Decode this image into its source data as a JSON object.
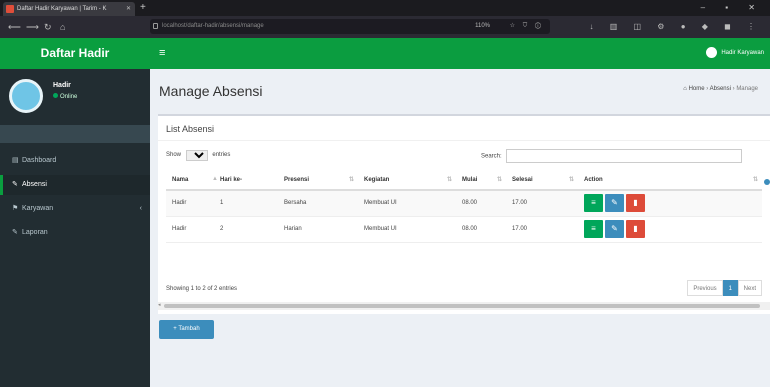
{
  "browser": {
    "tab_title": "Daftar Hadir Karyawan | Tarim - K",
    "new_tab": "+",
    "window_controls": "– ▪ ✕",
    "nav_back": "⟵",
    "nav_forward": "⟶",
    "nav_reload": "↻",
    "nav_home": "⌂",
    "url": "localhost/daftar-hadir/absensi/manage",
    "zoom": "110%",
    "url_tools": "☆ ⛉ ⓘ",
    "extensions": "↓ ▥ ◫ ⚙ ● ◆ ◼ ⋮"
  },
  "sidebar": {
    "brand": "Daftar Hadir",
    "user_name": "Hadir",
    "user_status": "Online",
    "menu": [
      {
        "icon": "▤",
        "label": "Dashboard"
      },
      {
        "icon": "✎",
        "label": "Absensi"
      },
      {
        "icon": "⚑",
        "label": "Karyawan"
      },
      {
        "icon": "✎",
        "label": "Laporan"
      }
    ],
    "caret": "‹"
  },
  "header": {
    "menu_toggle": "≡",
    "user_label": "Hadir Karyawan"
  },
  "page": {
    "title": "Manage Absensi",
    "breadcrumb": {
      "home": "⌂ Home",
      "sep1": "›",
      "section": "Absensi",
      "sep2": "›",
      "current": "Manage"
    }
  },
  "box": {
    "title": "List Absensi",
    "show_label": "Show",
    "show_value": "10",
    "entries_label": "entries",
    "search_label": "Search:",
    "search_placeholder": ""
  },
  "table": {
    "columns": [
      "Nama",
      "Hari ke-",
      "Presensi",
      "Kegiatan",
      "Mulai",
      "Selesai",
      "Action"
    ],
    "sort_glyph": "⇅",
    "sort_active": "▲",
    "rows": [
      [
        "Hadir",
        "1",
        "Bersaha",
        "Membuat UI",
        "08.00",
        "17.00"
      ],
      [
        "Hadir",
        "2",
        "Harian",
        "Membuat UI",
        "08.00",
        "17.00"
      ]
    ],
    "action_icons": {
      "view": "≡",
      "edit": "✎",
      "delete": "▮"
    }
  },
  "footer": {
    "info": "Showing 1 to 2 of 2 entries",
    "previous": "Previous",
    "page": "1",
    "next": "Next",
    "scroll_left": "◂"
  },
  "add_button": "+ Tambah"
}
